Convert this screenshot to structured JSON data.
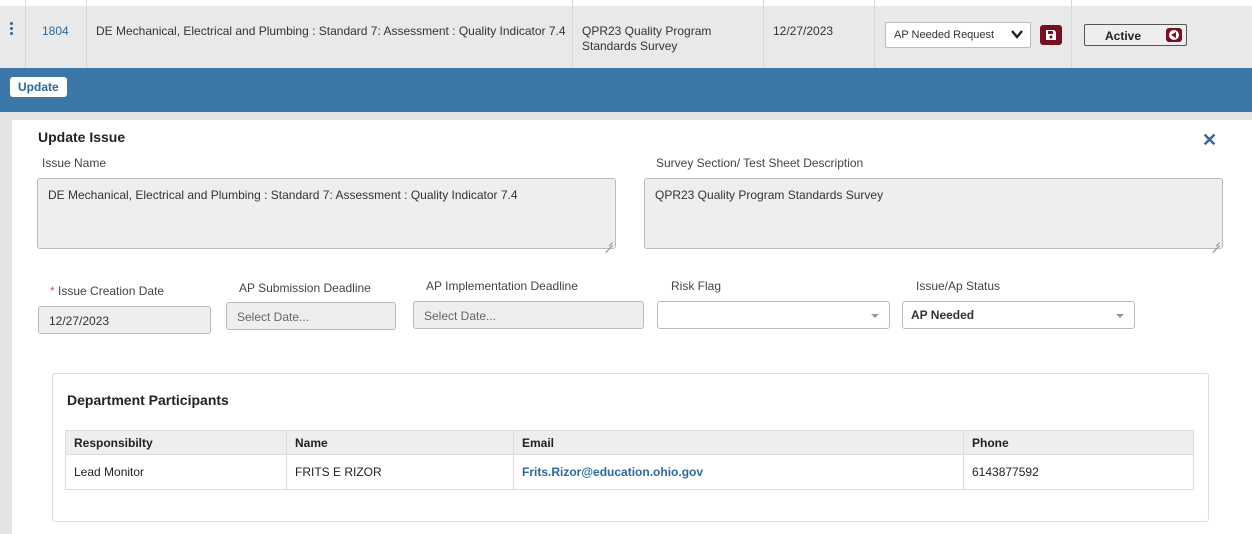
{
  "row": {
    "id": "1804",
    "issue": "DE Mechanical, Electrical and Plumbing : Standard 7: Assessment : Quality Indicator 7.4",
    "survey": "QPR23 Quality Program Standards Survey",
    "date": "12/27/2023",
    "ap_status_value": "AP Needed Request",
    "status": "Active"
  },
  "toolbar": {
    "update_label": "Update"
  },
  "panel": {
    "title": "Update Issue",
    "issue_name_label": "Issue Name",
    "issue_name_value": "DE Mechanical, Electrical and Plumbing : Standard 7: Assessment : Quality Indicator 7.4",
    "survey_label": "Survey Section/ Test Sheet Description",
    "survey_value": "QPR23 Quality Program Standards Survey",
    "creation_date_label": "Issue Creation Date",
    "creation_date_value": "12/27/2023",
    "ap_submission_label": "AP Submission Deadline",
    "ap_submission_placeholder": "Select Date...",
    "ap_implementation_label": "AP Implementation Deadline",
    "ap_implementation_placeholder": "Select Date...",
    "risk_flag_label": "Risk Flag",
    "risk_flag_value": "",
    "issue_status_label": "Issue/Ap Status",
    "issue_status_value": "AP Needed"
  },
  "participants": {
    "title": "Department Participants",
    "headers": [
      "Responsibilty",
      "Name",
      "Email",
      "Phone"
    ],
    "rows": [
      [
        "Lead Monitor",
        "FRITS E RIZOR",
        "Frits.Rizor@education.ohio.gov",
        "6143877592"
      ]
    ]
  },
  "colors": {
    "accent_blue": "#3b77a8",
    "link_blue": "#2b6aa0",
    "maroon": "#7a0f21"
  }
}
